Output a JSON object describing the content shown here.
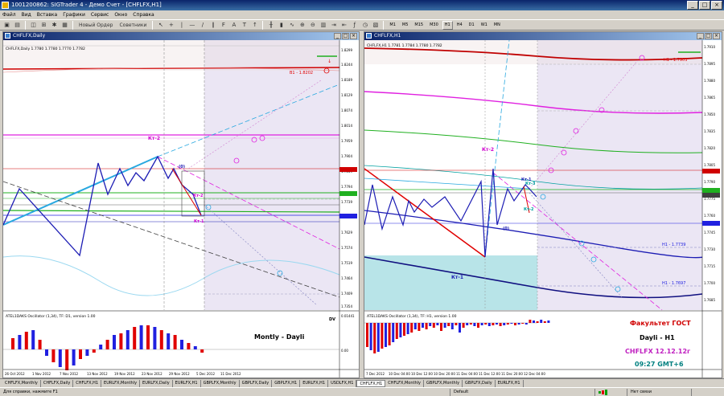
{
  "window": {
    "title": "1001200862: SIGTrader 4 - Демо Счет - [CHFLFX,H1]"
  },
  "menu": [
    "Файл",
    "Вид",
    "Вставка",
    "Графики",
    "Сервис",
    "Окно",
    "Справка"
  ],
  "toolbar": {
    "new_order": "Новый Ордер",
    "advisors": "Советники",
    "timeframes": [
      "M1",
      "M5",
      "M15",
      "M30",
      "H1",
      "H4",
      "D1",
      "W1",
      "MN"
    ]
  },
  "left_chart": {
    "window_title": "CHFLFX,Daily",
    "info": "CHFLFX,Daily 1.7780 1.7780 1.7770 1.7782",
    "price_labels": [
      "1.8299",
      "1.8244",
      "1.8189",
      "1.8129",
      "1.8074",
      "1.8014",
      "1.7959",
      "1.7904",
      "1.7849",
      "1.7794",
      "1.7739",
      "1.7684",
      "1.7629",
      "1.7574",
      "1.7519",
      "1.7464",
      "1.7409",
      "1.7354"
    ],
    "labels": {
      "kt2_top": "Кт-2",
      "kt0": "(0)",
      "kt2_right": "Кт-2",
      "kt1": "Кт-1",
      "b1": "B1 - 1.8202"
    },
    "osc_title": "ATEL1DAKS Oscillator (1,34), TF: D1, version 1.00",
    "osc_label": "DV",
    "osc_values": [
      "0.01441",
      "0.00"
    ],
    "montly": "Montly - Dayli",
    "dates": [
      "26 Oct 2012",
      "1 Nov 2012",
      "7 Nov 2012",
      "13 Nov 2012",
      "19 Nov 2012",
      "23 Nov 2012",
      "29 Nov 2012",
      "5 Dec 2012",
      "11 Dec 2012"
    ]
  },
  "right_chart": {
    "window_title": "CHFLFX,H1",
    "info": "CHFLFX,H1 1.7781 1.7784 1.7780 1.7782",
    "price_labels": [
      "1.7910",
      "1.7895",
      "1.7880",
      "1.7865",
      "1.7850",
      "1.7835",
      "1.7820",
      "1.7805",
      "1.7790",
      "1.7775",
      "1.7760",
      "1.7745",
      "1.7730",
      "1.7715",
      "1.7700",
      "1.7685"
    ],
    "labels": {
      "kt2": "Кт-2",
      "kt1_top": "Кт-1",
      "kt3": "Кт-3",
      "kt2b": "Кт-2",
      "kt0": "(0)",
      "kt1_bottom": "Кт-1",
      "h1": "H1 - 1.7903",
      "h1b": "H1 - 1.7739",
      "h1c": "H1 - 1.7697"
    },
    "osc_title": "ATEL1DAKS Oscillator (1,34), TF: H1, version 1.00",
    "text_block": {
      "line1": "Факультет ГОСТ",
      "line2": "Dayli - H1",
      "line3": "CHFLFX 12.12.12г",
      "line4": "09:27 GMT+6"
    },
    "dates": [
      "7 Dec 2012",
      "10 Dec 04:00",
      "10 Dec 12:00",
      "10 Dec 20:00",
      "11 Dec 04:00",
      "11 Dec 12:00",
      "11 Dec 20:00",
      "12 Dec 04:00"
    ]
  },
  "colors": {
    "kt": "#d000d0",
    "blue_zz": "#1c1cb4",
    "cyan": "#28a8e0",
    "red": "#e00000",
    "magenta": "#e020e0",
    "green": "#20b020",
    "navy": "#101080",
    "osc_red": "#e00000",
    "osc_blue": "#2020e0",
    "text_red": "#d00000",
    "text_purple": "#c020c0",
    "text_teal": "#008080"
  },
  "bottom_tabs": [
    "CHFLFX,Monthly",
    "CHFLFX,Daily",
    "CHFLFX,H1",
    "EURLFX,Monthly",
    "EURLFX,Daily",
    "EURLFX,H1",
    "GBPLFX,Monthly",
    "GBPLFX,Daily",
    "GBPLFX,H1",
    "EURLFX,H1",
    "USDLFX,H1",
    "CHFLFX,H1",
    "CHFLFX,Monthly",
    "GBPLFX,Monthly",
    "GBPLFX,Daily",
    "EURLFX,H1"
  ],
  "status": {
    "help": "Для справки, нажмите F1",
    "profile": "Default",
    "conn": "Нет связи"
  }
}
